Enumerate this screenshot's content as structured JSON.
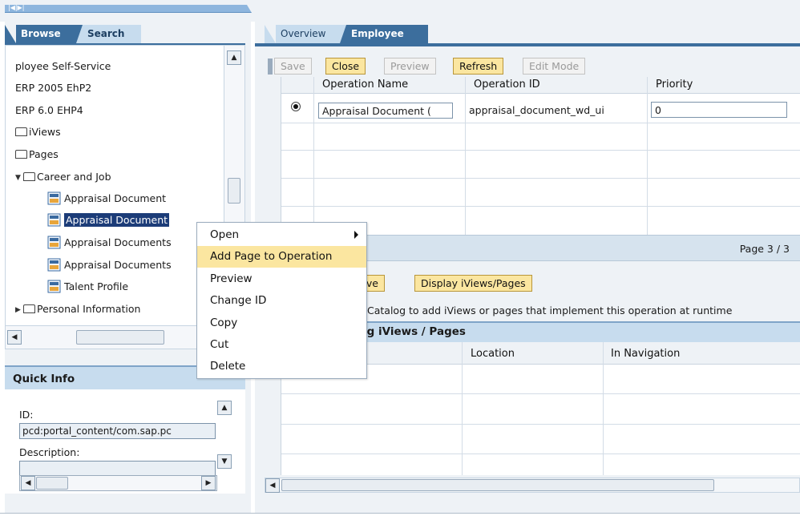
{
  "topbar": {
    "nav_arrows": "|◀|▶|"
  },
  "left": {
    "tabs": [
      {
        "label": "Browse"
      },
      {
        "label": "Search"
      }
    ],
    "tree": [
      {
        "label": "ployee Self-Service"
      },
      {
        "label": "ERP 2005 EhP2"
      },
      {
        "label": "ERP 6.0 EHP4"
      },
      {
        "label": "iViews"
      },
      {
        "label": "Pages"
      },
      {
        "label": "Career and Job"
      },
      {
        "label": "Appraisal Document"
      },
      {
        "label": "Appraisal Document"
      },
      {
        "label": "Appraisal Documents"
      },
      {
        "label": "Appraisal Documents"
      },
      {
        "label": "Talent Profile"
      },
      {
        "label": "Personal Information"
      }
    ],
    "quick_info": {
      "title": "Quick Info",
      "id_label": "ID:",
      "id_value": "pcd:portal_content/com.sap.pc",
      "description_label": "Description:"
    }
  },
  "right": {
    "tabs": [
      {
        "label": "Overview"
      },
      {
        "label": "Employee"
      }
    ],
    "toolbar": {
      "save": "Save",
      "close": "Close",
      "preview": "Preview",
      "refresh": "Refresh",
      "edit_mode": "Edit Mode"
    },
    "grid1": {
      "columns": [
        "Operation Name",
        "Operation ID",
        "Priority"
      ],
      "rows": [
        {
          "name": "Appraisal Document (",
          "id": "appraisal_document_wd_ui",
          "priority": "0"
        }
      ]
    },
    "pager": {
      "text": "Page 3 / 3"
    },
    "actions": {
      "remove": "move",
      "display": "Display iViews/Pages"
    },
    "info_text": "Catalog to add iViews or pages that implement this operation at runtime",
    "grid2": {
      "title": "ng iViews / Pages",
      "columns": [
        "Location",
        "In Navigation"
      ]
    }
  },
  "context_menu": {
    "items": [
      {
        "label": "Open"
      },
      {
        "label": "Add Page to Operation"
      },
      {
        "label": "Preview"
      },
      {
        "label": "Change ID"
      },
      {
        "label": "Copy"
      },
      {
        "label": "Cut"
      },
      {
        "label": "Delete"
      }
    ]
  },
  "colors": {
    "accent": "#3c6e9d",
    "highlight": "#fbe6a0",
    "panel": "#eef2f6"
  }
}
